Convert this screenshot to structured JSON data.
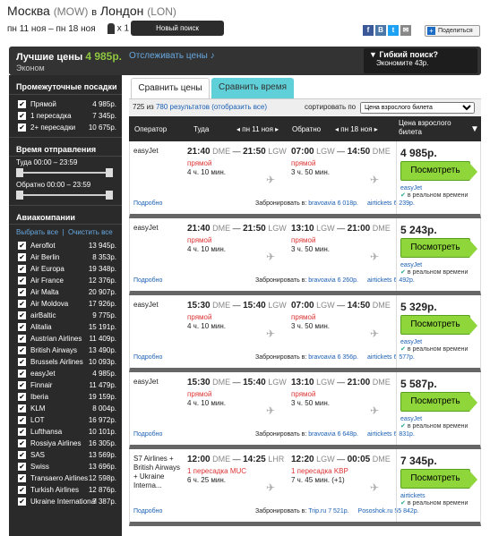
{
  "header": {
    "from": "Москва",
    "from_code": "(MOW)",
    "in": "в",
    "to": "Лондон",
    "to_code": "(LON)",
    "dates": "пн 11 ноя – пн 18 ноя",
    "pax": "x 1",
    "new_search": "Новый поиск",
    "share": "Поделиться",
    "social": [
      "f",
      "В",
      "t",
      "✉"
    ],
    "social_colors": [
      "#3b5998",
      "#4a76a8",
      "#1da1f2",
      "#888888"
    ]
  },
  "summary": {
    "best_label": "Лучшие цены",
    "best_price": "4 985р.",
    "track": "Отслеживать цены",
    "cabin": "Эконом",
    "flex_title": "Гибкий поиск?",
    "flex_text": "Экономите 43р."
  },
  "sidebar": {
    "stops_title": "Промежуточные посадки",
    "stops": [
      {
        "label": "Прямой",
        "value": "4 985р."
      },
      {
        "label": "1 пересадка",
        "value": "7 345р."
      },
      {
        "label": "2+ пересадки",
        "value": "10 675р."
      }
    ],
    "dep_title": "Время отправления",
    "there": "Туда 00:00 – 23:59",
    "back": "Обратно 00:00 – 23:59",
    "airlines_title": "Авиакомпании",
    "select_all": "Выбрать все",
    "clear_all": "Очистить все",
    "airlines": [
      {
        "label": "Aeroflot",
        "value": "13 945р."
      },
      {
        "label": "Air Berlin",
        "value": "8 353р."
      },
      {
        "label": "Air Europa",
        "value": "19 348р."
      },
      {
        "label": "Air France",
        "value": "12 376р."
      },
      {
        "label": "Air Malta",
        "value": "20 907р."
      },
      {
        "label": "Air Moldova",
        "value": "17 926р."
      },
      {
        "label": "airBaltic",
        "value": "9 775р."
      },
      {
        "label": "Alitalia",
        "value": "15 191р."
      },
      {
        "label": "Austrian Airlines",
        "value": "11 409р."
      },
      {
        "label": "British Airways",
        "value": "13 490р."
      },
      {
        "label": "Brussels Airlines",
        "value": "10 093р."
      },
      {
        "label": "easyJet",
        "value": "4 985р."
      },
      {
        "label": "Finnair",
        "value": "11 479р."
      },
      {
        "label": "Iberia",
        "value": "19 159р."
      },
      {
        "label": "KLM",
        "value": "8 004р."
      },
      {
        "label": "LOT",
        "value": "16 972р."
      },
      {
        "label": "Lufthansa",
        "value": "10 101р."
      },
      {
        "label": "Rossiya Airlines",
        "value": "16 305р."
      },
      {
        "label": "SAS",
        "value": "13 569р."
      },
      {
        "label": "Swiss",
        "value": "13 696р."
      },
      {
        "label": "Transaero Airlines",
        "value": "12 598р."
      },
      {
        "label": "Turkish Airlines",
        "value": "12 876р."
      },
      {
        "label": "Ukraine International",
        "value": "7 387р."
      }
    ]
  },
  "tabs": {
    "prices": "Сравнить цены",
    "time": "Сравнить время"
  },
  "results": {
    "count_prefix": "725 из",
    "count_link": "780 результатов (отобразить все)",
    "sort_label": "сортировать по",
    "sort_value": "Цена взрослого билета"
  },
  "table_head": {
    "operator": "Оператор",
    "there": "Туда",
    "there_date": "◂ пн 11 ноя ▸",
    "back": "Обратно",
    "back_date": "◂ пн 18 ноя ▸",
    "price": "Цена взрослого билета"
  },
  "cards": [
    {
      "op": "easyJet",
      "d1": "21:40",
      "a1": "DME",
      "d2": "21:50",
      "a2": "LGW",
      "ddir": "прямой",
      "ddur": "4 ч. 10 мин.",
      "r1": "07:00",
      "ra1": "LGW",
      "r2": "14:50",
      "ra2": "DME",
      "rdir": "прямой",
      "rdur": "3 ч. 50 мин.",
      "det": "Подробно",
      "book": "Забронировать в:",
      "b1": "bravoavia 6 018р.",
      "b2": "airtickets 6 239р.",
      "price": "4 985р.",
      "btn": "Посмотреть",
      "src": "easyJet",
      "rt": "в реальном времени"
    },
    {
      "op": "easyJet",
      "d1": "21:40",
      "a1": "DME",
      "d2": "21:50",
      "a2": "LGW",
      "ddir": "прямой",
      "ddur": "4 ч. 10 мин.",
      "r1": "13:10",
      "ra1": "LGW",
      "r2": "21:00",
      "ra2": "DME",
      "rdir": "прямой",
      "rdur": "3 ч. 50 мин.",
      "det": "Подробно",
      "book": "Забронировать в:",
      "b1": "bravoavia 6 260р.",
      "b2": "airtickets 6 492р.",
      "price": "5 243р.",
      "btn": "Посмотреть",
      "src": "easyJet",
      "rt": "в реальном времени"
    },
    {
      "op": "easyJet",
      "d1": "15:30",
      "a1": "DME",
      "d2": "15:40",
      "a2": "LGW",
      "ddir": "прямой",
      "ddur": "4 ч. 10 мин.",
      "r1": "07:00",
      "ra1": "LGW",
      "r2": "14:50",
      "ra2": "DME",
      "rdir": "прямой",
      "rdur": "3 ч. 50 мин.",
      "det": "Подробно",
      "book": "Забронировать в:",
      "b1": "bravoavia 6 356р.",
      "b2": "airtickets 6 577р.",
      "price": "5 329р.",
      "btn": "Посмотреть",
      "src": "easyJet",
      "rt": "в реальном времени"
    },
    {
      "op": "easyJet",
      "d1": "15:30",
      "a1": "DME",
      "d2": "15:40",
      "a2": "LGW",
      "ddir": "прямой",
      "ddur": "4 ч. 10 мин.",
      "r1": "13:10",
      "ra1": "LGW",
      "r2": "21:00",
      "ra2": "DME",
      "rdir": "прямой",
      "rdur": "3 ч. 50 мин.",
      "det": "Подробно",
      "book": "Забронировать в:",
      "b1": "bravoavia 6 648р.",
      "b2": "airtickets 6 831р.",
      "price": "5 587р.",
      "btn": "Посмотреть",
      "src": "easyJet",
      "rt": "в реальном времени"
    },
    {
      "op": "S7 Airlines + British Airways + Ukraine Interna...",
      "d1": "12:00",
      "a1": "DME",
      "d2": "14:25",
      "a2": "LHR",
      "ddir": "1 пересадка MUC",
      "ddur": "6 ч. 25 мин.",
      "r1": "12:20",
      "ra1": "LGW",
      "r2": "00:05",
      "ra2": "DME",
      "rdir": "1 пересадка KBP",
      "rdur": "7 ч. 45 мин. (+1)",
      "det": "Подробно",
      "book": "Забронировать в:",
      "b1": "Trip.ru 7 521р.",
      "b2": "Pososhok.ru 55 842р.",
      "price": "7 345р.",
      "btn": "Посмотреть",
      "src": "airtickets",
      "rt": "в реальном времени"
    }
  ]
}
